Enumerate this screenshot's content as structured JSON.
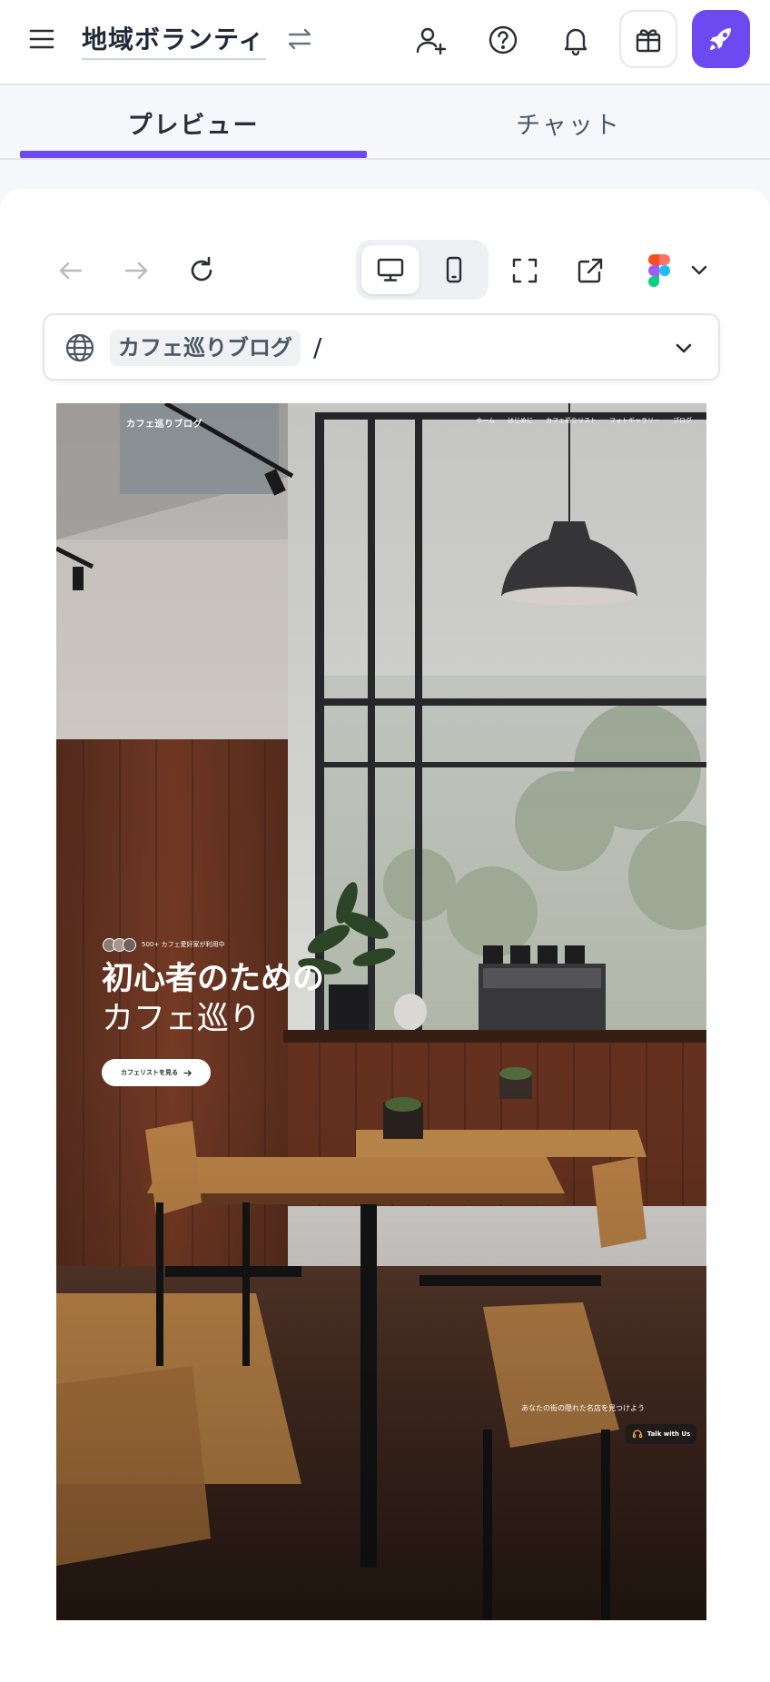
{
  "header": {
    "project_title": "地域ボランティ",
    "icons": [
      "menu-icon",
      "swap-icon",
      "add-user-icon",
      "help-icon",
      "bell-icon",
      "gift-icon",
      "rocket-icon"
    ]
  },
  "tabs": [
    {
      "label": "プレビュー",
      "active": true
    },
    {
      "label": "チャット",
      "active": false
    }
  ],
  "toolbar": {
    "icons": [
      "back-arrow-icon",
      "forward-arrow-icon",
      "reload-icon",
      "desktop-icon",
      "mobile-icon",
      "fullscreen-icon",
      "external-link-icon",
      "figma-icon",
      "chevron-down-icon"
    ],
    "active_device": "desktop"
  },
  "urlbar": {
    "site_name": "カフェ巡りブログ",
    "path": "/"
  },
  "preview": {
    "logo": "カフェ巡りブログ",
    "nav": [
      "ホーム",
      "はじめに",
      "カフェ巡りリスト",
      "フォトギャラリー",
      "ブログ"
    ],
    "users_text": "500+ カフェ愛好家が利用中",
    "hero_line1": "初心者のための",
    "hero_line2": "カフェ巡り",
    "cta_label": "カフェリストを見る",
    "tagline": "あなたの街の隠れた名店を見つけよう",
    "talk_label": "Talk with Us"
  },
  "colors": {
    "accent": "#6d4af0",
    "tab_underline": "#6d4af0",
    "panel_bg": "#ffffff",
    "page_bg": "#f6f7fb"
  }
}
